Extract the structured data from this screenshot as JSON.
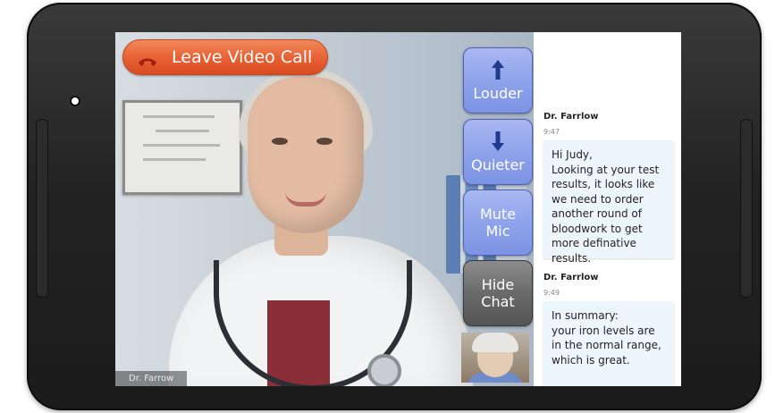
{
  "call": {
    "leave_label": "Leave Video Call",
    "remote_name": "Dr. Farrow"
  },
  "controls": {
    "louder": "Louder",
    "quieter": "Quieter",
    "mute": "Mute\nMic",
    "hide_chat": "Hide\nChat"
  },
  "chat": {
    "messages": [
      {
        "sender": "Dr. Farrlow",
        "time": "9:47",
        "text": "Hi Judy,\nLooking at your test results, it looks like we need to order another round of bloodwork to get more definative results."
      },
      {
        "sender": "Dr. Farrlow",
        "time": "9:49",
        "text": "In summary:\nyour iron levels are in the normal range, which is great."
      }
    ]
  },
  "colors": {
    "leave_button": "#e65f32",
    "control_blue": "#8ea3ea",
    "control_gray": "#6a6a6a",
    "chat_bubble": "#eef6fd"
  },
  "icons": {
    "leave": "phone-hangup-icon",
    "louder": "arrow-up-icon",
    "quieter": "arrow-down-icon"
  }
}
